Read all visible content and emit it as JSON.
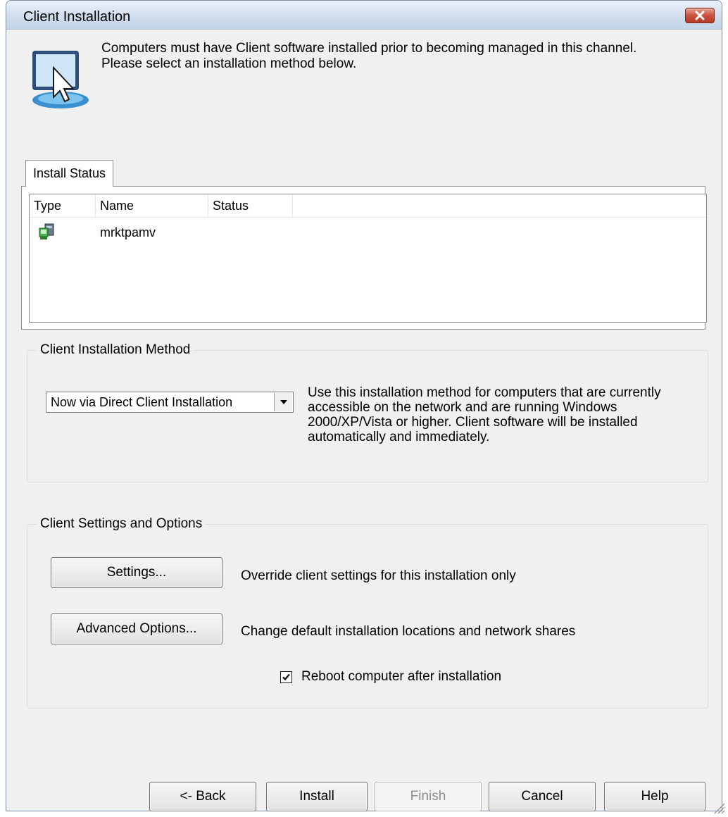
{
  "window": {
    "title": "Client Installation"
  },
  "header": {
    "icon": "monitor-cursor-icon",
    "text": "Computers must have Client software installed prior to becoming managed in this channel.  Please select an installation method below."
  },
  "install_status": {
    "tab_label": "Install Status",
    "columns": [
      "Type",
      "Name",
      "Status"
    ],
    "rows": [
      {
        "type_icon": "computer-icon",
        "name": "mrktpamv",
        "status": ""
      }
    ]
  },
  "install_method": {
    "group_label": "Client Installation Method",
    "selected": "Now via Direct Client Installation",
    "description": "Use this installation method for computers that are currently accessible on the network and are running Windows 2000/XP/Vista or higher.  Client software will be installed automatically and immediately."
  },
  "settings_options": {
    "group_label": "Client Settings and Options",
    "settings_button": "Settings...",
    "settings_desc": "Override client settings for this installation only",
    "advanced_button": "Advanced Options...",
    "advanced_desc": "Change default installation locations and network shares",
    "reboot_label": "Reboot computer after installation",
    "reboot_checked": true
  },
  "footer": {
    "back": "<- Back",
    "install": "Install",
    "finish": "Finish",
    "cancel": "Cancel",
    "help": "Help"
  }
}
